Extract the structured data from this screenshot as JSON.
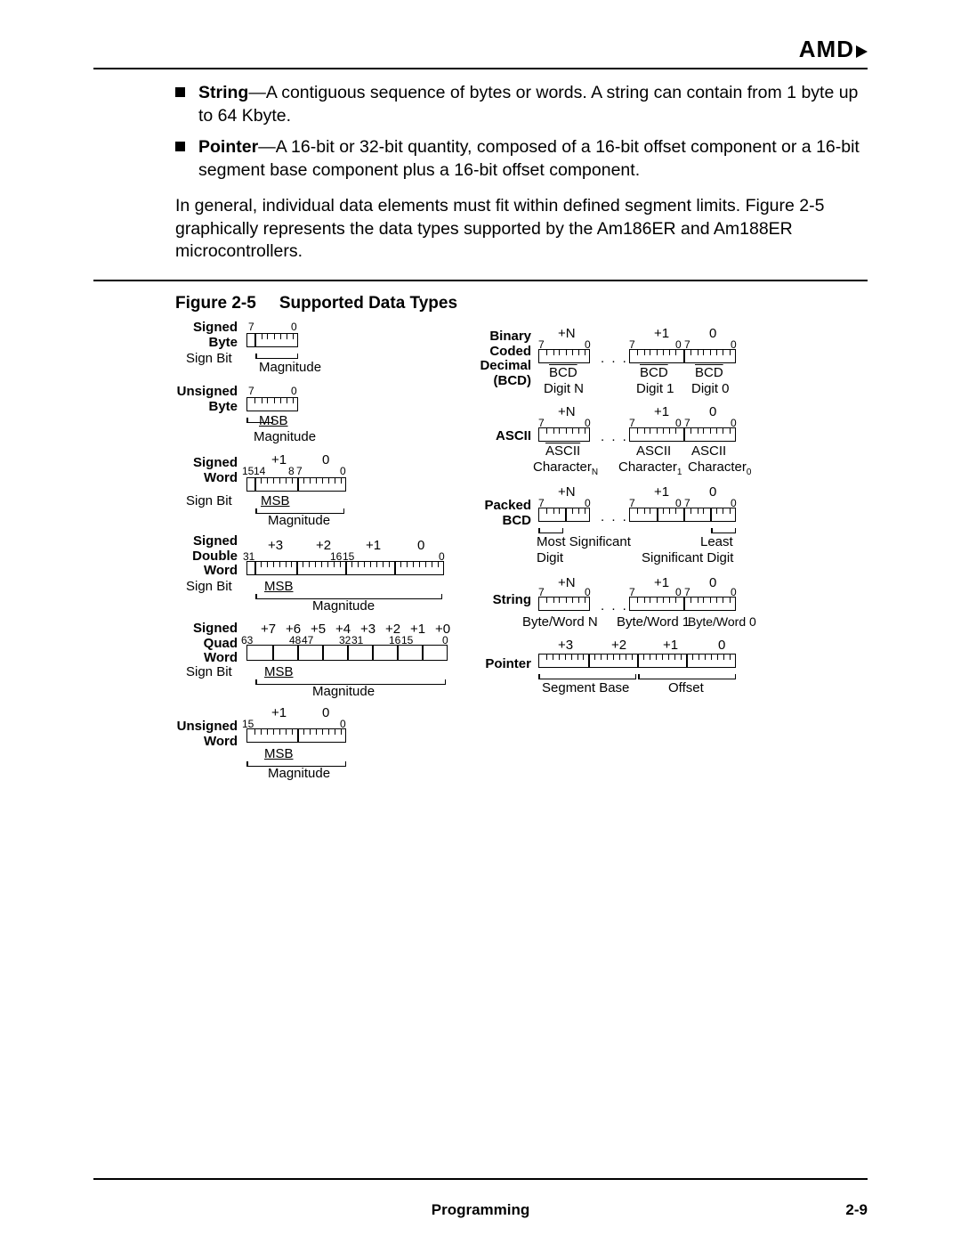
{
  "header": {
    "logo": "AMD"
  },
  "bullets": [
    {
      "term": "String",
      "desc": "—A contiguous sequence of bytes or words. A string can contain from 1 byte up to 64 Kbyte."
    },
    {
      "term": "Pointer",
      "desc": "—A 16-bit or 32-bit quantity, composed of a 16-bit offset component or a 16-bit segment base component plus a 16-bit offset component."
    }
  ],
  "paragraph": "In general, individual data elements must fit within defined segment limits. Figure 2-5 graphically represents the data types supported by the Am186ER and Am188ER microcontrollers.",
  "figure": {
    "num": "Figure 2-5",
    "title": "Supported Data Types"
  },
  "left": {
    "sbyte": {
      "l1": "Signed",
      "l2": "Byte",
      "bits": [
        "7",
        "0"
      ],
      "sign": "Sign Bit",
      "msb": "",
      "mag": "Magnitude"
    },
    "ubyte": {
      "l1": "Unsigned",
      "l2": "Byte",
      "bits": [
        "7",
        "0"
      ],
      "msb": "MSB",
      "mag": "Magnitude"
    },
    "sword": {
      "l1": "Signed",
      "l2": "Word",
      "tops": [
        "+1",
        "0"
      ],
      "bits": [
        "15",
        "14",
        "8",
        "7",
        "0"
      ],
      "sign": "Sign Bit",
      "msb": "MSB",
      "mag": "Magnitude"
    },
    "sdword": {
      "l1": "Signed",
      "l2": "Double",
      "l3": "Word",
      "tops": [
        "+3",
        "+2",
        "+1",
        "0"
      ],
      "bits": [
        "31",
        "16",
        "15",
        "0"
      ],
      "sign": "Sign Bit",
      "msb": "MSB",
      "mag": "Magnitude"
    },
    "sqword": {
      "l1": "Signed",
      "l2": "Quad",
      "l3": "Word",
      "tops": [
        "+7",
        "+6",
        "+5",
        "+4",
        "+3",
        "+2",
        "+1",
        "+0"
      ],
      "bits": [
        "63",
        "48",
        "47",
        "32",
        "31",
        "16",
        "15",
        "0"
      ],
      "sign": "Sign Bit",
      "msb": "MSB",
      "mag": "Magnitude"
    },
    "uword": {
      "l1": "Unsigned",
      "l2": "Word",
      "tops": [
        "+1",
        "0"
      ],
      "bits": [
        "15",
        "0"
      ],
      "msb": "MSB",
      "mag": "Magnitude"
    }
  },
  "right": {
    "bcd": {
      "l1": "Binary",
      "l2": "Coded",
      "l3": "Decimal",
      "l4": "(BCD)",
      "tops": [
        "+N",
        "+1",
        "0"
      ],
      "bits": [
        "7",
        "0",
        "7",
        "0",
        "7",
        "0"
      ],
      "u1": "BCD",
      "u2": "BCD",
      "u3": "BCD",
      "d1": "Digit N",
      "d2": "Digit 1",
      "d3": "Digit 0",
      "dots": ". . ."
    },
    "ascii": {
      "l1": "ASCII",
      "tops": [
        "+N",
        "+1",
        "0"
      ],
      "bits": [
        "7",
        "0",
        "7",
        "0",
        "7",
        "0"
      ],
      "u1": "ASCII",
      "u2": "ASCII",
      "u3": "ASCII",
      "d1n": "Character",
      "d1s": "N",
      "d2n": "Character",
      "d2s": "1",
      "d3n": "Character",
      "d3s": "0",
      "dots": ". . ."
    },
    "pbcd": {
      "l1": "Packed",
      "l2": "BCD",
      "tops": [
        "+N",
        "+1",
        "0"
      ],
      "bits": [
        "7",
        "0",
        "7",
        "0",
        "7",
        "0"
      ],
      "msd": "Most Significant",
      "msd2": "Digit",
      "lsd": "Least",
      "lsd2": "Significant Digit",
      "dots": ". . ."
    },
    "string": {
      "l1": "String",
      "tops": [
        "+N",
        "+1",
        "0"
      ],
      "bits": [
        "7",
        "0",
        "7",
        "0",
        "7",
        "0"
      ],
      "u1": "Byte/Word N",
      "u2": "Byte/Word 1",
      "u3": "Byte/Word 0",
      "dots": ". . ."
    },
    "pointer": {
      "l1": "Pointer",
      "tops": [
        "+3",
        "+2",
        "+1",
        "0"
      ],
      "u1": "Segment Base",
      "u2": "Offset"
    }
  },
  "footer": {
    "title": "Programming",
    "page": "2-9"
  }
}
